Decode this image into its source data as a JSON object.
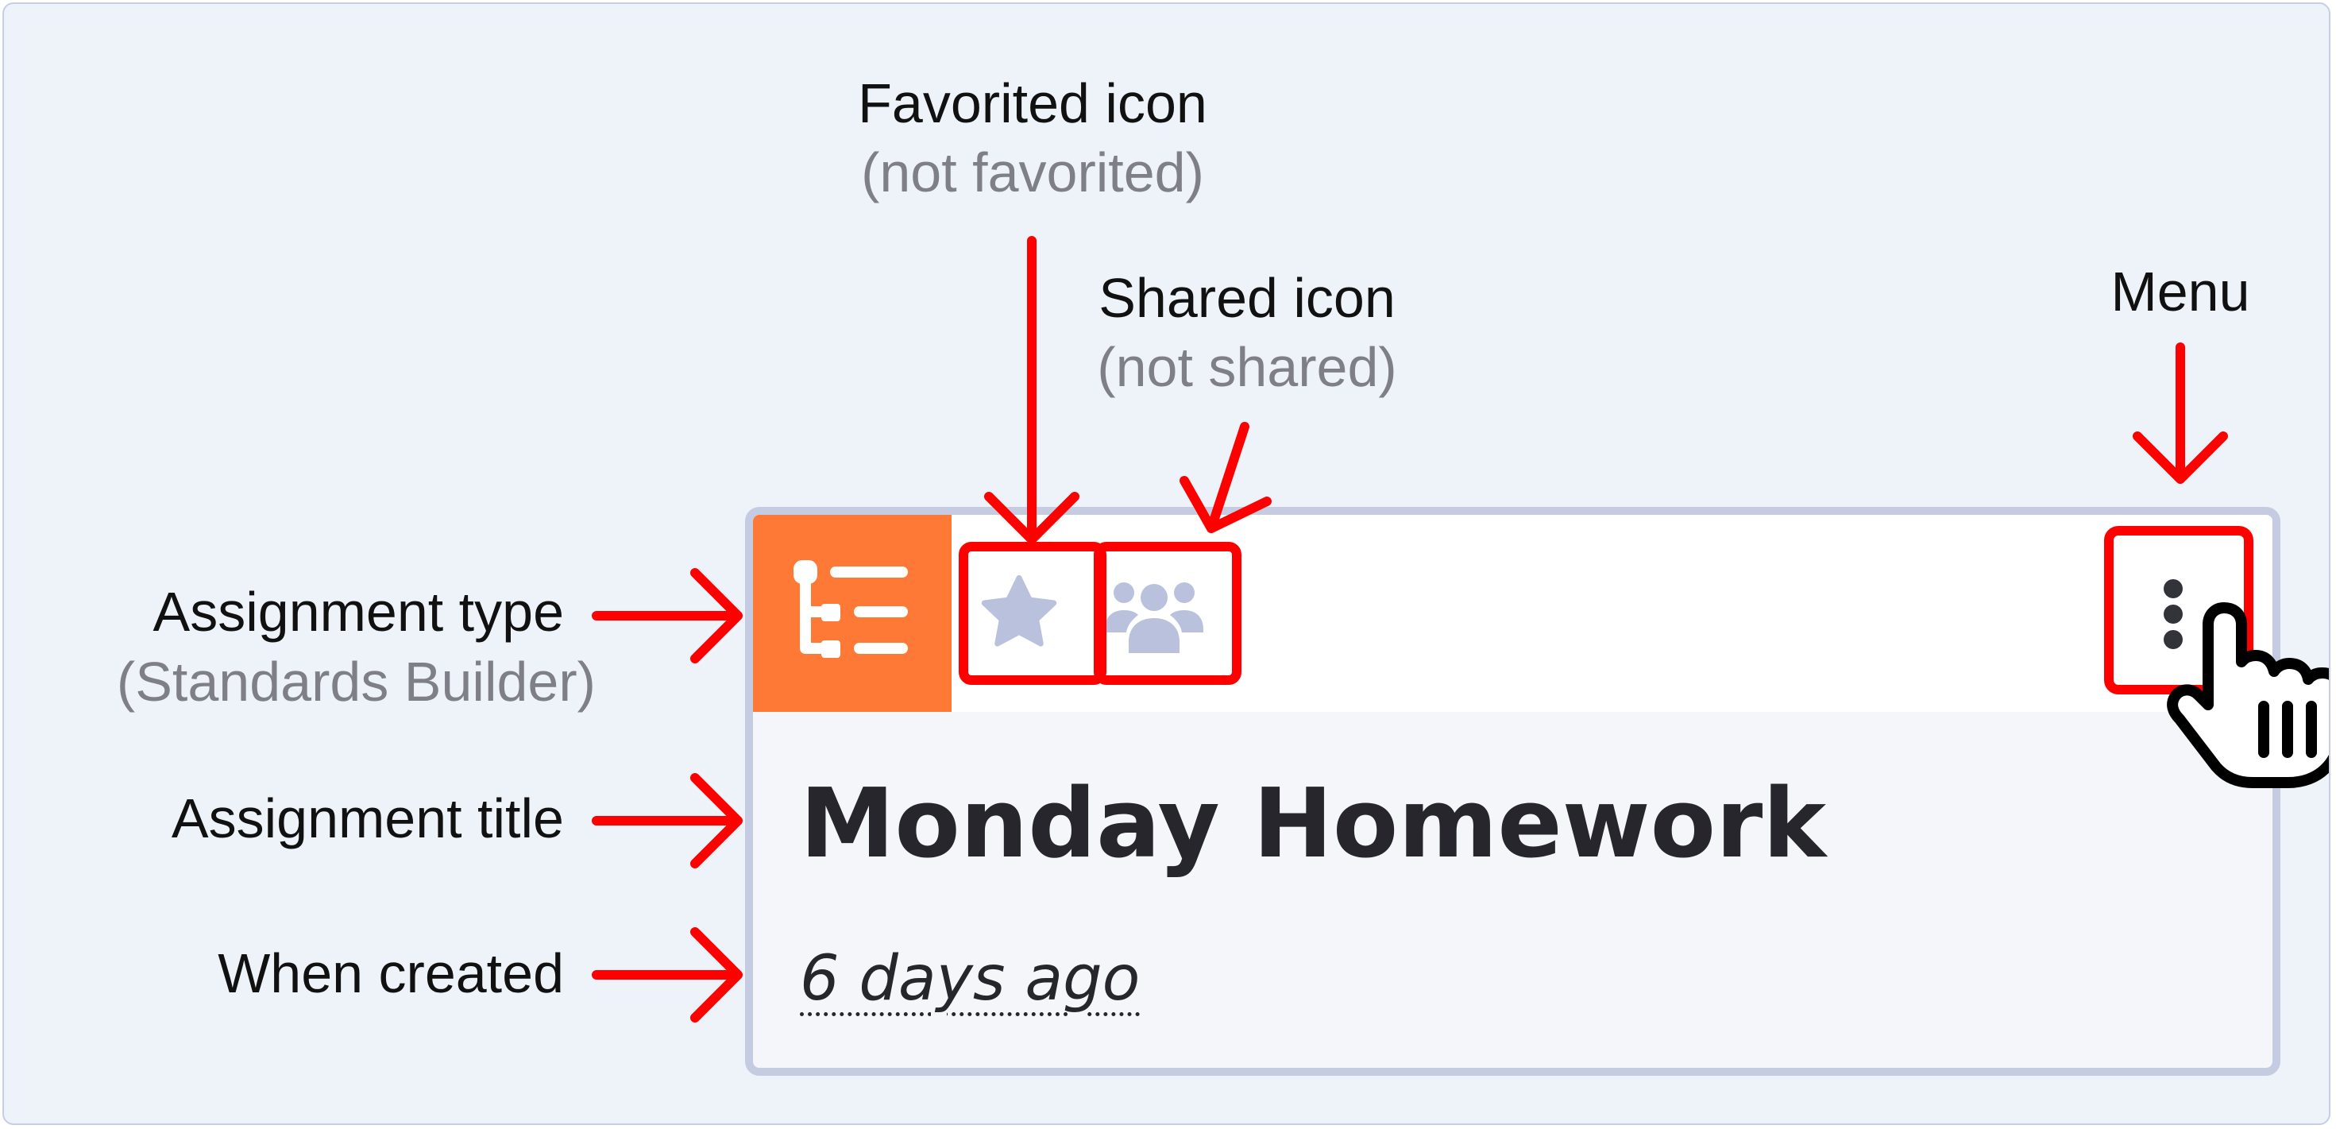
{
  "annotations": {
    "favorited": {
      "label": "Favorited icon",
      "state": "(not favorited)"
    },
    "shared": {
      "label": "Shared icon",
      "state": "(not shared)"
    },
    "menu": {
      "label": "Menu"
    },
    "assignment_type": {
      "label": "Assignment type",
      "value": "(Standards Builder)"
    },
    "assignment_title": {
      "label": "Assignment title"
    },
    "when_created": {
      "label": "When created"
    }
  },
  "card": {
    "title": "Monday Homework",
    "created": "6 days ago",
    "type_icon": "standards-builder-icon",
    "favorite_icon": "star-icon",
    "shared_icon": "people-group-icon",
    "menu_icon": "vertical-ellipsis-icon"
  },
  "colors": {
    "type_tile": "#fd7935",
    "icon_muted": "#b9c1dc",
    "card_border": "#c5cce2",
    "highlight": "#ff0000",
    "page_bg": "#eef3fa"
  }
}
